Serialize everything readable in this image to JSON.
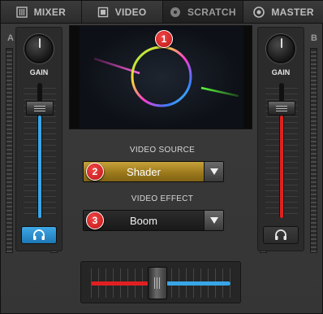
{
  "tabs": [
    {
      "label": "MIXER",
      "icon": "mixer-icon",
      "active": false
    },
    {
      "label": "VIDEO",
      "icon": "video-icon",
      "active": true
    },
    {
      "label": "SCRATCH",
      "icon": "scratch-icon",
      "active": false
    },
    {
      "label": "MASTER",
      "icon": "master-icon",
      "active": false
    }
  ],
  "deck_a": {
    "letter": "A",
    "gain_label": "GAIN",
    "volume_fraction": 0.85,
    "fader_color": "#38a6e6",
    "headphone_cue_active": true,
    "headphone_icon": "headphones-icon"
  },
  "deck_b": {
    "letter": "B",
    "gain_label": "GAIN",
    "volume_fraction": 0.85,
    "fader_color": "#e02020",
    "headphone_cue_active": false,
    "headphone_icon": "headphones-icon"
  },
  "video_source": {
    "label": "VIDEO SOURCE",
    "value": "Shader"
  },
  "video_effect": {
    "label": "VIDEO EFFECT",
    "value": "Boom"
  },
  "badges": [
    "1",
    "2",
    "3"
  ],
  "crossfader": {
    "position": 0.47,
    "left_color": "#e02020",
    "right_color": "#38a6e6"
  },
  "colors": {
    "accent_blue": "#38a6e6",
    "accent_red": "#e02020",
    "source_gold": "#c8a23a",
    "badge_red": "#d52020"
  }
}
